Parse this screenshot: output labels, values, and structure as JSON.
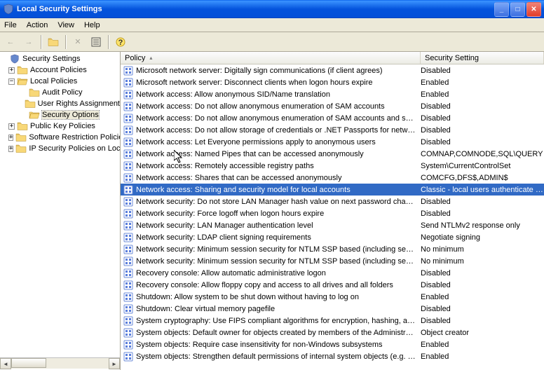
{
  "window": {
    "title": "Local Security Settings"
  },
  "menu": {
    "file": "File",
    "action": "Action",
    "view": "View",
    "help": "Help"
  },
  "tree": {
    "root": "Security Settings",
    "account_policies": "Account Policies",
    "local_policies": "Local Policies",
    "audit_policy": "Audit Policy",
    "user_rights": "User Rights Assignment",
    "security_options": "Security Options",
    "public_key": "Public Key Policies",
    "srp": "Software Restriction Policies",
    "ipsec": "IP Security Policies on Local Computer"
  },
  "columns": {
    "policy": "Policy",
    "setting": "Security Setting"
  },
  "rows": [
    {
      "p": "Microsoft network server: Digitally sign communications (if client agrees)",
      "s": "Disabled"
    },
    {
      "p": "Microsoft network server: Disconnect clients when logon hours expire",
      "s": "Enabled"
    },
    {
      "p": "Network access: Allow anonymous SID/Name translation",
      "s": "Enabled"
    },
    {
      "p": "Network access: Do not allow anonymous enumeration of SAM accounts",
      "s": "Disabled"
    },
    {
      "p": "Network access: Do not allow anonymous enumeration of SAM accounts and shares",
      "s": "Disabled"
    },
    {
      "p": "Network access: Do not allow storage of credentials or .NET Passports for network authentication",
      "s": "Disabled"
    },
    {
      "p": "Network access: Let Everyone permissions apply to anonymous users",
      "s": "Disabled"
    },
    {
      "p": "Network access: Named Pipes that can be accessed anonymously",
      "s": "COMNAP,COMNODE,SQL\\QUERY"
    },
    {
      "p": "Network access: Remotely accessible registry paths",
      "s": "System\\CurrentControlSet"
    },
    {
      "p": "Network access: Shares that can be accessed anonymously",
      "s": "COMCFG,DFS$,ADMIN$"
    },
    {
      "p": "Network access: Sharing and security model for local accounts",
      "s": "Classic - local users authenticate as themselves",
      "selected": true
    },
    {
      "p": "Network security: Do not store LAN Manager hash value on next password change",
      "s": "Disabled"
    },
    {
      "p": "Network security: Force logoff when logon hours expire",
      "s": "Disabled"
    },
    {
      "p": "Network security: LAN Manager authentication level",
      "s": "Send NTLMv2 response only"
    },
    {
      "p": "Network security: LDAP client signing requirements",
      "s": "Negotiate signing"
    },
    {
      "p": "Network security: Minimum session security for NTLM SSP based (including secure RPC) clients",
      "s": "No minimum"
    },
    {
      "p": "Network security: Minimum session security for NTLM SSP based (including secure RPC) servers",
      "s": "No minimum"
    },
    {
      "p": "Recovery console: Allow automatic administrative logon",
      "s": "Disabled"
    },
    {
      "p": "Recovery console: Allow floppy copy and access to all drives and all folders",
      "s": "Disabled"
    },
    {
      "p": "Shutdown: Allow system to be shut down without having to log on",
      "s": "Enabled"
    },
    {
      "p": "Shutdown: Clear virtual memory pagefile",
      "s": "Disabled"
    },
    {
      "p": "System cryptography: Use FIPS compliant algorithms for encryption, hashing, and signing",
      "s": "Disabled"
    },
    {
      "p": "System objects: Default owner for objects created by members of the Administrators group",
      "s": "Object creator"
    },
    {
      "p": "System objects: Require case insensitivity for non-Windows subsystems",
      "s": "Enabled"
    },
    {
      "p": "System objects: Strengthen default permissions of internal system objects (e.g. Symbolic Links)",
      "s": "Enabled"
    }
  ]
}
